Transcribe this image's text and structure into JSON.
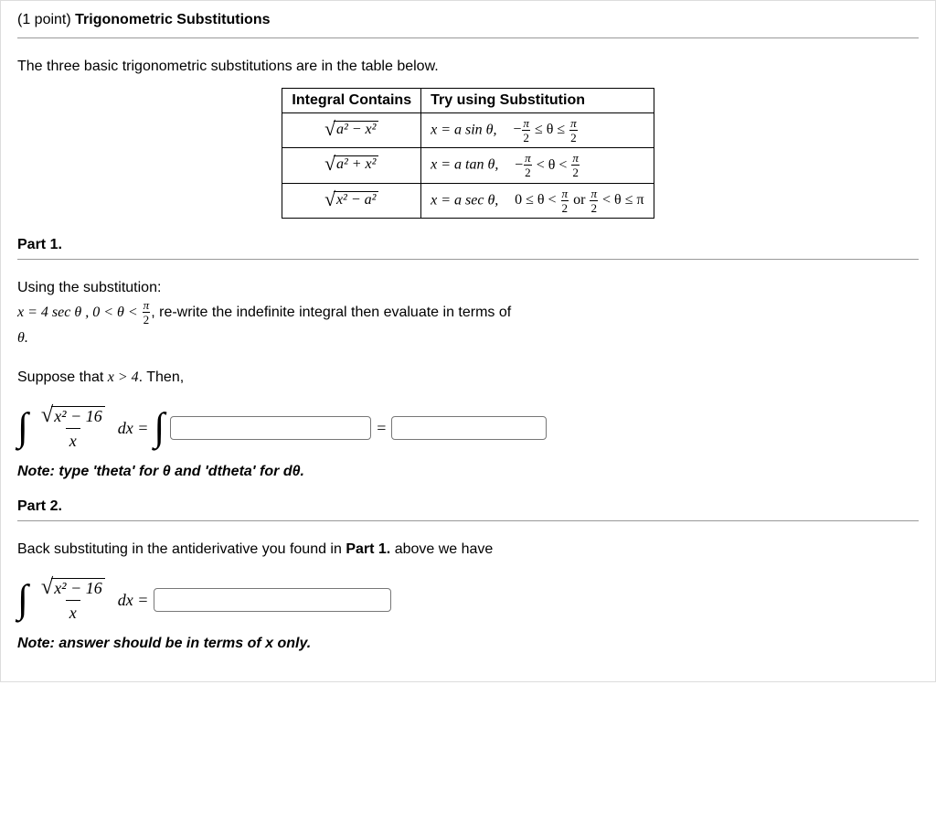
{
  "header": {
    "points": "(1 point)",
    "title": "Trigonometric Substitutions"
  },
  "intro": "The three basic trigonometric substitutions are in the table below.",
  "table": {
    "col1": "Integral Contains",
    "col2": "Try using Substitution",
    "rows": [
      {
        "contains": {
          "radicand": "a² − x²"
        },
        "sub": "x = a sin θ,",
        "range_prefix": "−",
        "range_mid": "≤ θ ≤",
        "frac": {
          "num": "π",
          "den": "2"
        }
      },
      {
        "contains": {
          "radicand": "a² + x²"
        },
        "sub": "x = a tan θ,",
        "range_prefix": "−",
        "range_mid": "< θ <",
        "frac": {
          "num": "π",
          "den": "2"
        }
      },
      {
        "contains": {
          "radicand": "x² − a²"
        },
        "sub": "x = a sec θ,",
        "range1_left": "0 ≤ θ <",
        "range_or": " or ",
        "range2_mid": "< θ ≤ π",
        "frac": {
          "num": "π",
          "den": "2"
        }
      }
    ]
  },
  "part1": {
    "label": "Part 1.",
    "line1a": "Using the substitution:",
    "sub_eq": "x = 4 sec θ , 0 < θ < ",
    "sub_frac": {
      "num": "π",
      "den": "2"
    },
    "line1b": ", re-write the indefinite integral then evaluate in terms of",
    "line1c": "θ.",
    "line2a": "Suppose that ",
    "line2b": "x > 4",
    "line2c": ". Then,",
    "integral": {
      "radicand": "x² − 16",
      "denom": "x",
      "dx": "dx ="
    },
    "eqsym": "=",
    "note": "Note: type 'theta' for θ and 'dtheta' for dθ."
  },
  "part2": {
    "label": "Part 2.",
    "text_a": "Back substituting in the antiderivative you found in ",
    "text_b": "Part 1.",
    "text_c": " above we have",
    "integral": {
      "radicand": "x² − 16",
      "denom": "x",
      "dx": "dx ="
    },
    "note": "Note: answer should be in terms of x only."
  },
  "inputs": {
    "p1a": "",
    "p1b": "",
    "p2": ""
  }
}
